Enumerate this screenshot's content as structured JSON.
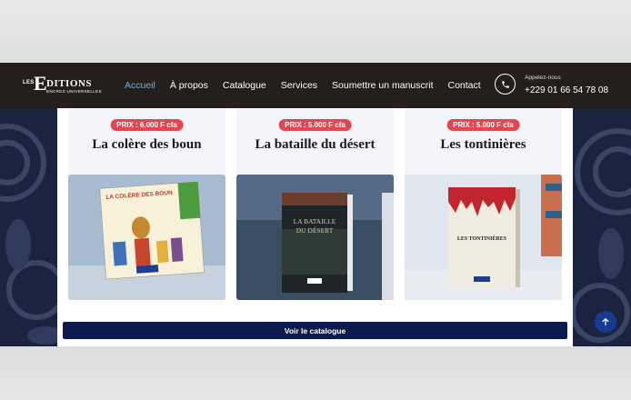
{
  "logo": {
    "les": "LES",
    "e": "E",
    "ditions": "DITIONS",
    "encres": "ENCRES UNIVERSELLES"
  },
  "nav": {
    "items": [
      {
        "label": "Accueil",
        "active": true
      },
      {
        "label": "À propos"
      },
      {
        "label": "Catalogue"
      },
      {
        "label": "Services"
      },
      {
        "label": "Soumettre un manuscrit"
      },
      {
        "label": "Contact"
      }
    ]
  },
  "contact": {
    "label": "Appelez-nous",
    "phone": "+229 01 66 54 78 08",
    "icon": "phone-icon"
  },
  "books": [
    {
      "price": "PRIX : 6.000 F cfa",
      "title": "La colère des boun",
      "cover_text": "LA COLÈRE DES BOUN"
    },
    {
      "price": "PRIX : 5.000 F cfa",
      "title": "La bataille du désert",
      "cover_text": "LA BATAILLE DU DÉSERT"
    },
    {
      "price": "PRIX : 5.000 F cfa",
      "title": "Les tontinières",
      "cover_text": "LES TONTINIÈRES"
    }
  ],
  "catalogue_button": "Voir le catalogue",
  "scroll_top_icon": "arrow-up-icon",
  "colors": {
    "header": "#241e1c",
    "accent_nav": "#67b3e6",
    "price_badge": "#e24650",
    "button": "#0e1a4e",
    "background_pattern": "#1b2340"
  }
}
